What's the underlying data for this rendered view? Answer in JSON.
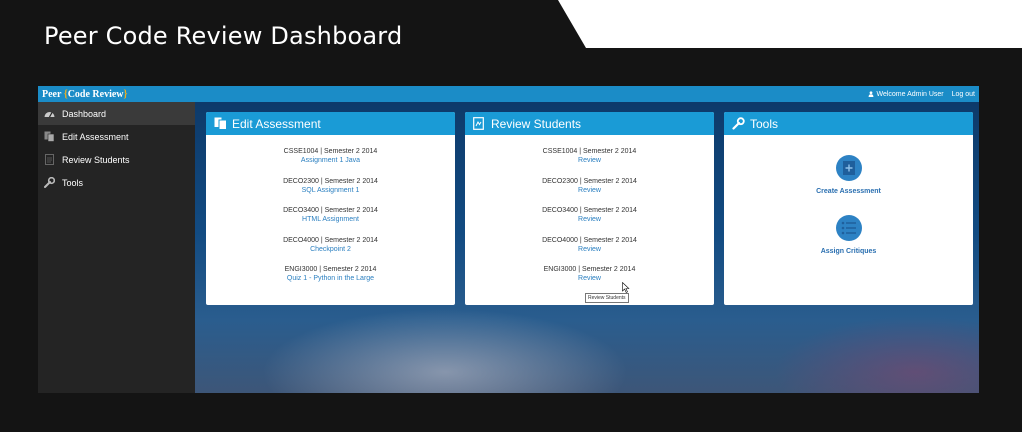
{
  "slide": {
    "title": "Peer Code Review Dashboard"
  },
  "topbar": {
    "brand_prefix": "Peer ",
    "brand_open": "{",
    "brand_name": "Code Review",
    "brand_close": "}",
    "welcome": "Welcome Admin User",
    "logout": "Log out"
  },
  "sidebar": {
    "items": [
      {
        "label": "Dashboard",
        "icon": "dashboard-icon",
        "active": true
      },
      {
        "label": "Edit Assessment",
        "icon": "copy-icon"
      },
      {
        "label": "Review Students",
        "icon": "document-icon"
      },
      {
        "label": "Tools",
        "icon": "wrench-icon"
      }
    ]
  },
  "cards": {
    "edit": {
      "title": "Edit Assessment",
      "entries": [
        {
          "course": "CSSE1004 | Semester 2 2014",
          "link": "Assignment 1 Java"
        },
        {
          "course": "DECO2300 | Semester 2 2014",
          "link": "SQL Assignment 1"
        },
        {
          "course": "DECO3400 | Semester 2 2014",
          "link": "HTML Assignment"
        },
        {
          "course": "DECO4000 | Semester 2 2014",
          "link": "Checkpoint 2"
        },
        {
          "course": "ENGI3000 | Semester 2 2014",
          "link": "Quiz 1 - Python in the Large"
        }
      ]
    },
    "review": {
      "title": "Review Students",
      "entries": [
        {
          "course": "CSSE1004 | Semester 2 2014",
          "link": "Review"
        },
        {
          "course": "DECO2300 | Semester 2 2014",
          "link": "Review"
        },
        {
          "course": "DECO3400 | Semester 2 2014",
          "link": "Review"
        },
        {
          "course": "DECO4000 | Semester 2 2014",
          "link": "Review"
        },
        {
          "course": "ENGI3000 | Semester 2 2014",
          "link": "Review"
        }
      ]
    },
    "tools": {
      "title": "Tools",
      "items": [
        {
          "label": "Create Assessment",
          "icon": "add-document-icon"
        },
        {
          "label": "Assign Critiques",
          "icon": "list-icon"
        }
      ]
    }
  },
  "tooltip": {
    "text": "Review Students"
  },
  "colors": {
    "topbar": "#1b8cc7",
    "card_header": "#1a9bd6",
    "sidebar": "#242424",
    "link": "#2a7fc0",
    "brand_accent": "#f0b020"
  }
}
